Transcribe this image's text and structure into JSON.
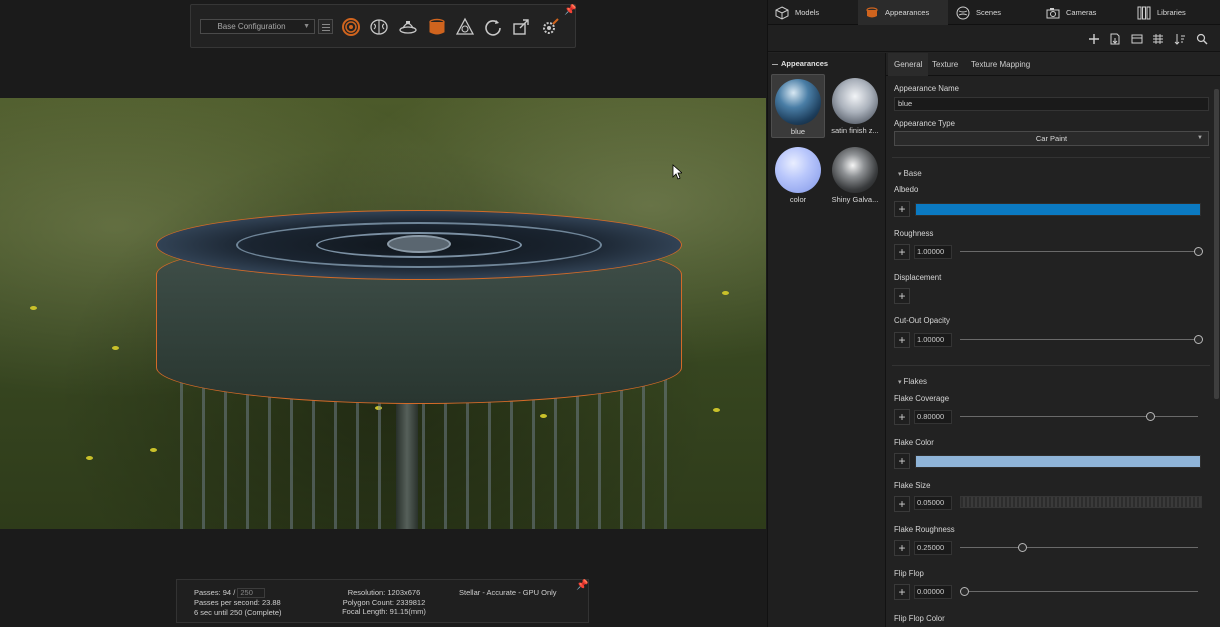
{
  "toolbar": {
    "config_select": "Base Configuration",
    "icons": [
      "render-target-icon",
      "brain-icon",
      "environment-icon",
      "material-bucket-icon",
      "geometry-icon",
      "refresh-icon",
      "export-icon",
      "settings-icon"
    ]
  },
  "status": {
    "passes_label": "Passes: 94 / ",
    "passes_max": "250",
    "passes_per_second": "Passes per second: 23.88",
    "time_remaining": "6 sec until 250 (Complete)",
    "resolution": "Resolution: 1203x676",
    "polygon_count": "Polygon Count: 2339812",
    "focal_length": "Focal Length: 91.15(mm)",
    "render_mode": "Stellar - Accurate - GPU Only"
  },
  "panel_tabs": [
    {
      "label": "Models",
      "icon": "cube-icon"
    },
    {
      "label": "Appearances",
      "icon": "appearance-icon"
    },
    {
      "label": "Scenes",
      "icon": "globe-icon"
    },
    {
      "label": "Cameras",
      "icon": "camera-icon"
    },
    {
      "label": "Libraries",
      "icon": "library-icon"
    }
  ],
  "actions": [
    "add-icon",
    "import-icon",
    "layout-icon",
    "grid-icon",
    "sort-icon",
    "search-icon"
  ],
  "appearances": {
    "title": "Appearances",
    "items": [
      {
        "label": "blue",
        "selected": true,
        "color": "#3f6f9a"
      },
      {
        "label": "satin finish z...",
        "selected": false,
        "color": "#c8ccd2"
      },
      {
        "label": "color",
        "selected": false,
        "color": "#a9b9f3"
      },
      {
        "label": "Shiny Galva...",
        "selected": false,
        "color": "#7c7f82"
      }
    ]
  },
  "props": {
    "tabs": [
      "General",
      "Texture",
      "Texture Mapping"
    ],
    "name_label": "Appearance Name",
    "name_value": "blue",
    "type_label": "Appearance Type",
    "type_value": "Car Paint",
    "base_section": "Base",
    "albedo_label": "Albedo",
    "albedo_color": "#0b7ac2",
    "roughness_label": "Roughness",
    "roughness_value": "1.00000",
    "displacement_label": "Displacement",
    "cutout_label": "Cut-Out Opacity",
    "cutout_value": "1.00000",
    "flakes_section": "Flakes",
    "flake_coverage_label": "Flake Coverage",
    "flake_coverage_value": "0.80000",
    "flake_color_label": "Flake Color",
    "flake_color": "#8fb4d8",
    "flake_size_label": "Flake Size",
    "flake_size_value": "0.05000",
    "flake_roughness_label": "Flake Roughness",
    "flake_roughness_value": "0.25000",
    "flip_flop_label": "Flip Flop",
    "flip_flop_value": "0.00000",
    "flip_flop_color_label": "Flip Flop Color"
  }
}
